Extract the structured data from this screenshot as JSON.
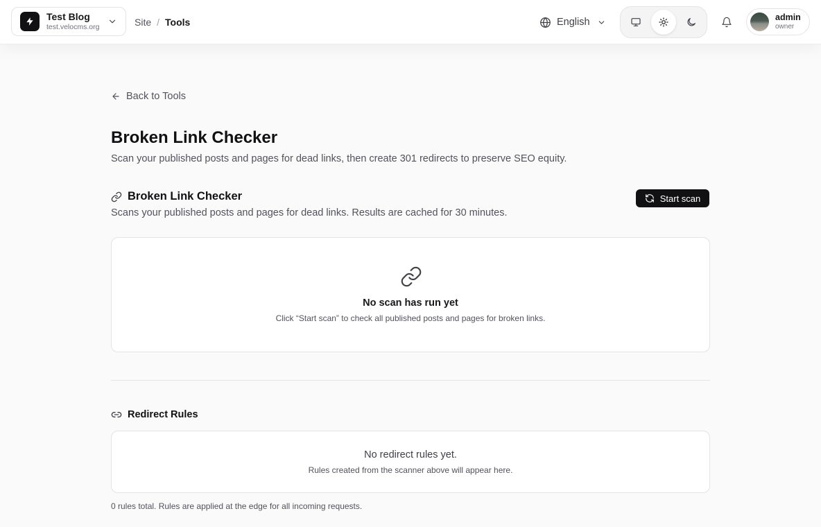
{
  "header": {
    "site": {
      "name": "Test Blog",
      "domain": "test.velocms.org",
      "logo_icon": "bolt-icon"
    },
    "breadcrumb": {
      "parent": "Site",
      "separator": "/",
      "current": "Tools"
    },
    "language": {
      "selected": "English"
    },
    "theme": {
      "options": [
        "system",
        "light",
        "dark"
      ],
      "selected": "light"
    },
    "user": {
      "name": "admin",
      "role": "owner"
    }
  },
  "page": {
    "back_label": "Back to Tools",
    "title": "Broken Link Checker",
    "description": "Scan your published posts and pages for dead links, then create 301 redirects to preserve SEO equity."
  },
  "checker": {
    "title": "Broken Link Checker",
    "description": "Scans your published posts and pages for dead links. Results are cached for 30 minutes.",
    "start_label": "Start scan",
    "empty": {
      "title": "No scan has run yet",
      "subtitle": "Click “Start scan” to check all published posts and pages for broken links."
    }
  },
  "redirects": {
    "title": "Redirect Rules",
    "empty": {
      "title": "No redirect rules yet.",
      "subtitle": "Rules created from the scanner above will appear here."
    },
    "footer": "0 rules total. Rules are applied at the edge for all incoming requests."
  },
  "colors": {
    "background": "#fafafa",
    "primary": "#111113",
    "muted_text": "#52525b",
    "border": "#e4e4e7"
  }
}
